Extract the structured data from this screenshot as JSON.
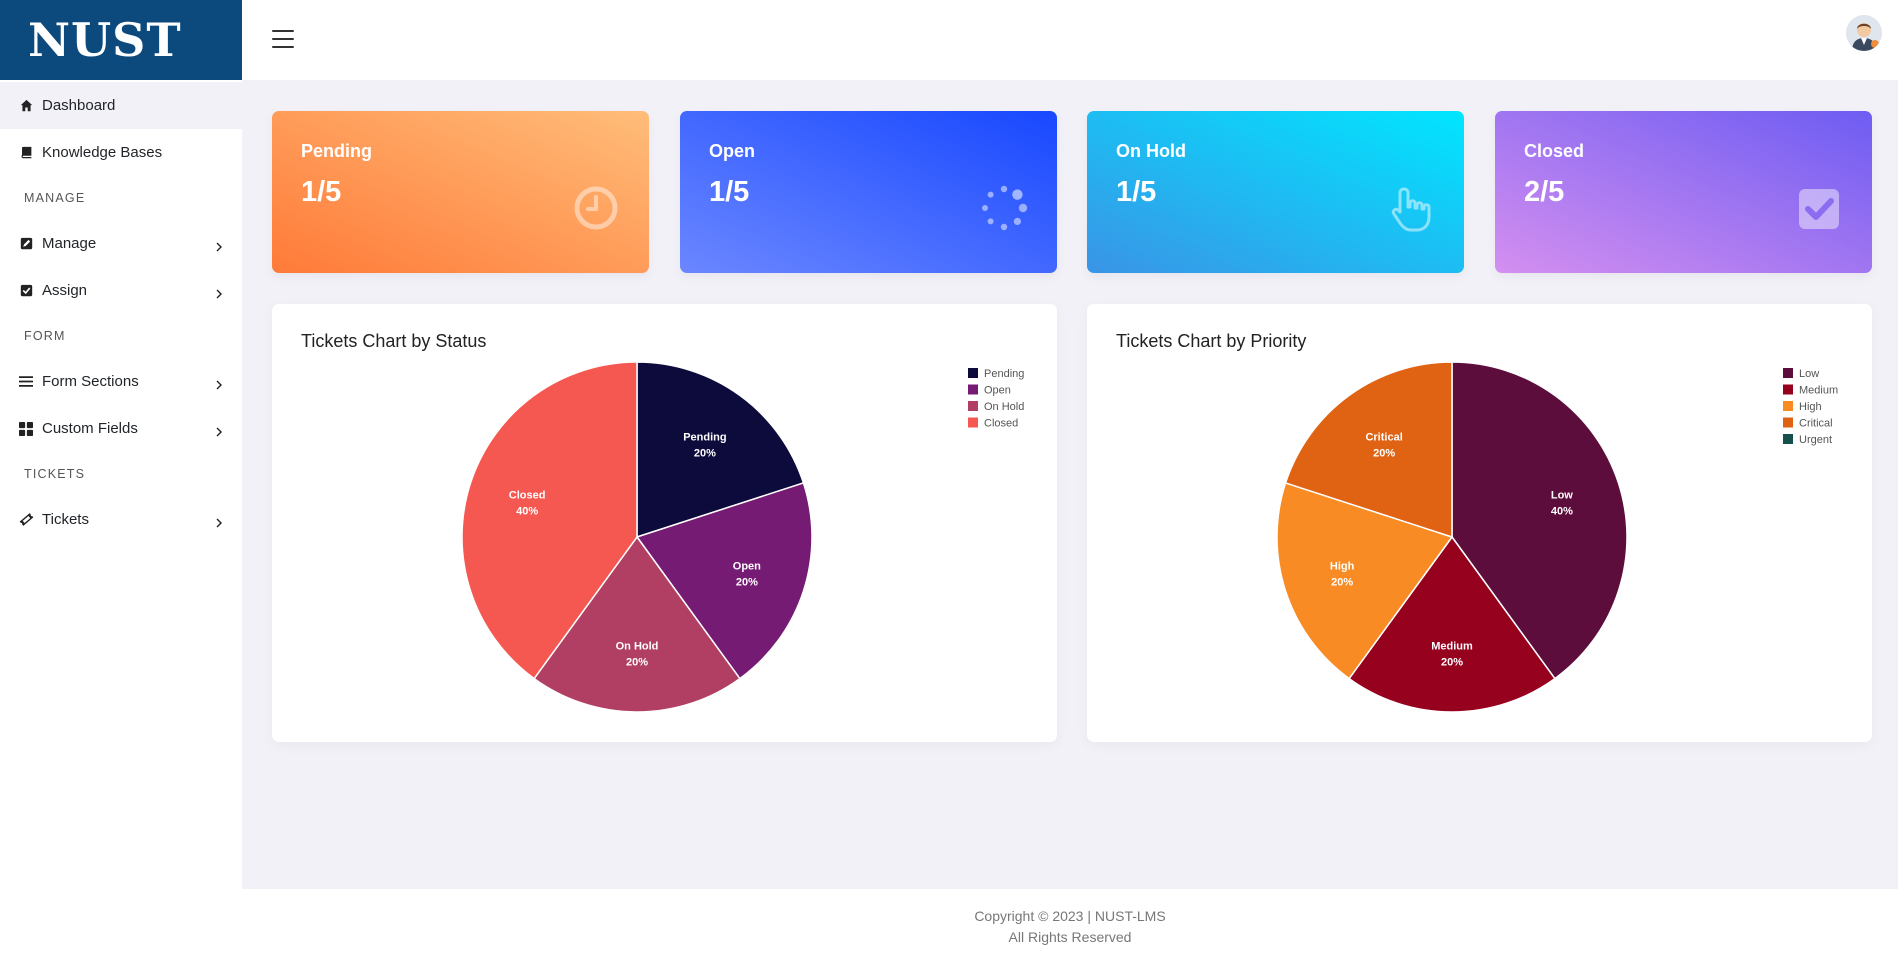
{
  "brand": {
    "logo_text": "NUST"
  },
  "sidebar": {
    "items": [
      {
        "type": "link",
        "label": "Dashboard",
        "icon": "home-icon",
        "active": true
      },
      {
        "type": "link",
        "label": "Knowledge Bases",
        "icon": "book-icon"
      },
      {
        "type": "heading",
        "label": "MANAGE"
      },
      {
        "type": "link",
        "label": "Manage",
        "icon": "edit-icon",
        "chevron": true
      },
      {
        "type": "link",
        "label": "Assign",
        "icon": "check-square-icon",
        "chevron": true
      },
      {
        "type": "heading",
        "label": "FORM"
      },
      {
        "type": "link",
        "label": "Form Sections",
        "icon": "list-icon",
        "chevron": true
      },
      {
        "type": "link",
        "label": "Custom Fields",
        "icon": "grid-icon",
        "chevron": true
      },
      {
        "type": "heading",
        "label": "TICKETS"
      },
      {
        "type": "link",
        "label": "Tickets",
        "icon": "ticket-icon",
        "chevron": true
      }
    ]
  },
  "topbar": {
    "menu_icon": "hamburger-icon",
    "avatar_icon": "user-avatar-icon"
  },
  "cards": {
    "pending": {
      "title": "Pending",
      "value": "1/5",
      "icon": "clock-icon"
    },
    "open": {
      "title": "Open",
      "value": "1/5",
      "icon": "spinner-icon"
    },
    "hold": {
      "title": "On Hold",
      "value": "1/5",
      "icon": "hand-pointer-icon"
    },
    "closed": {
      "title": "Closed",
      "value": "2/5",
      "icon": "checkbox-icon"
    }
  },
  "chart_data": [
    {
      "type": "pie",
      "title": "Tickets Chart by Status",
      "legend_position": "top-right",
      "slices": [
        {
          "label": "Pending",
          "value": 20,
          "display": "20%",
          "color": "#0d0a3c"
        },
        {
          "label": "Open",
          "value": 20,
          "display": "20%",
          "color": "#761b74"
        },
        {
          "label": "On Hold",
          "value": 20,
          "display": "20%",
          "color": "#b13f63"
        },
        {
          "label": "Closed",
          "value": 40,
          "display": "40%",
          "color": "#f55751"
        }
      ]
    },
    {
      "type": "pie",
      "title": "Tickets Chart by Priority",
      "legend_position": "top-right",
      "slices": [
        {
          "label": "Low",
          "value": 40,
          "display": "40%",
          "color": "#5c0d3b"
        },
        {
          "label": "Medium",
          "value": 20,
          "display": "20%",
          "color": "#96011e"
        },
        {
          "label": "High",
          "value": 20,
          "display": "20%",
          "color": "#f88b24"
        },
        {
          "label": "Critical",
          "value": 20,
          "display": "20%",
          "color": "#e06313"
        },
        {
          "label": "Urgent",
          "value": 0,
          "display": "0%",
          "color": "#15504f"
        }
      ]
    }
  ],
  "footer": {
    "line1": "Copyright © 2023 | NUST-LMS",
    "line2": "All Rights Reserved"
  }
}
